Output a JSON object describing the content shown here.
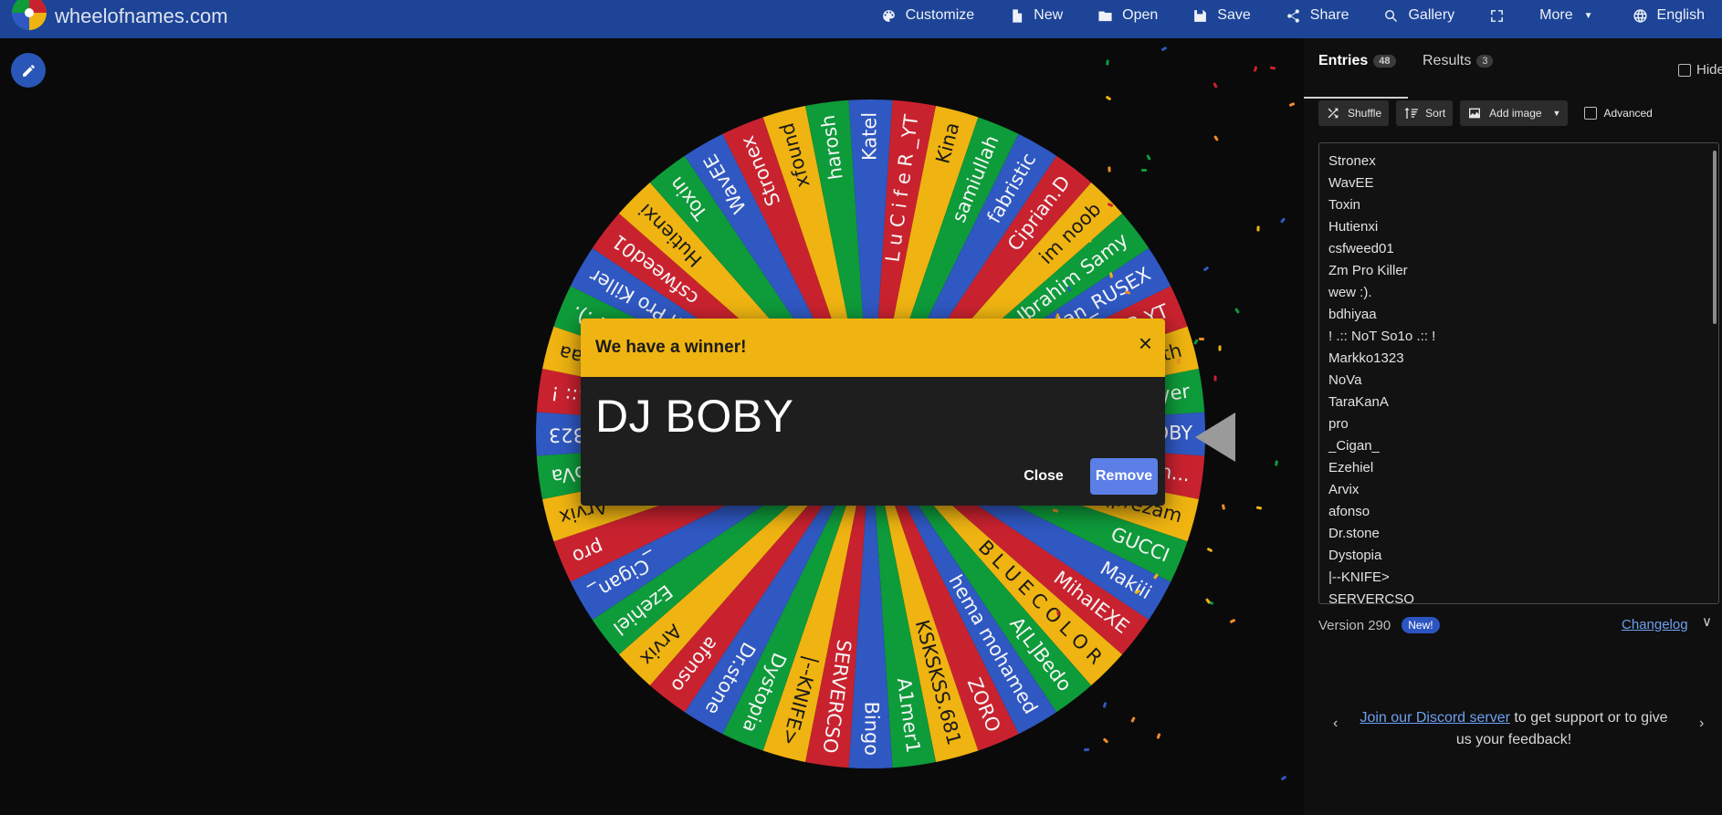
{
  "header": {
    "site_title": "wheelofnames.com",
    "menu": [
      {
        "label": "Customize",
        "icon": "palette-icon"
      },
      {
        "label": "New",
        "icon": "file-icon"
      },
      {
        "label": "Open",
        "icon": "folder-icon"
      },
      {
        "label": "Save",
        "icon": "save-icon"
      },
      {
        "label": "Share",
        "icon": "share-icon"
      },
      {
        "label": "Gallery",
        "icon": "search-icon"
      },
      {
        "label": "",
        "icon": "fullscreen-icon"
      },
      {
        "label": "More",
        "icon": "chevron-down-icon"
      },
      {
        "label": "English",
        "icon": "globe-icon"
      }
    ]
  },
  "wheel": {
    "segment_colors": [
      "#2f58c2",
      "#c9222f",
      "#efb411",
      "#0e9b3a"
    ],
    "labels": [
      "DJ BOBY",
      "ChipiChipiChapaCh...",
      "qprezam",
      "GUCCI",
      "Makiii",
      "MihaIEXE",
      "B L U E C O L O R",
      "A[L]Bedo",
      "hema mohamed",
      "ZORO",
      "KSKSKSS.681",
      "A1mer1",
      "Bingo",
      "SERVERCSO",
      "|--KNIFE>",
      "Dystopia",
      "Dr.stone",
      "afonso",
      "Arvix",
      "Ezehiel",
      "_Cigan_",
      "pro",
      "Arvix",
      "NoVa",
      "Markko1323",
      "! .:: NoT So1o .:: !",
      "bdhiyaa",
      "wew :).",
      "Zm Pro Killer",
      "csfweed01",
      "Hutienxi",
      "Toxin",
      "WavEE",
      "Stronex",
      "xfound",
      "harosh",
      "Katel",
      "L u C i f e R _YT",
      "Kina",
      "samiullah",
      "fabristic",
      "Ciprian.D",
      "im noob",
      "Ibrahim Samy",
      "Ruslan_RUSEX",
      "L U C I F E R YT",
      "Jutamenth",
      "Gamer player"
    ]
  },
  "modal": {
    "title": "We have a winner!",
    "close_x": "×",
    "winner": "DJ BOBY",
    "close_label": "Close",
    "remove_label": "Remove"
  },
  "panel": {
    "tab_entries": "Entries",
    "entries_count": "48",
    "tab_results": "Results",
    "results_count": "3",
    "hide_label": "Hide",
    "shuffle_label": "Shuffle",
    "sort_label": "Sort",
    "add_image_label": "Add image",
    "advanced_label": "Advanced",
    "entries": [
      "Stronex",
      "WavEE",
      "Toxin",
      "Hutienxi",
      "csfweed01",
      "Zm Pro Killer",
      "wew :).",
      "bdhiyaa",
      "! .:: NoT So1o .:: !",
      "Markko1323",
      "NoVa",
      "TaraKanA",
      "pro",
      "_Cigan_",
      "Ezehiel",
      "Arvix",
      "afonso",
      "Dr.stone",
      "Dystopia",
      "|--KNIFE>",
      "SERVERCSO"
    ],
    "version_label": "Version 290",
    "new_badge": "New!",
    "changelog_label": "Changelog",
    "discord_link": "Join our Discord server",
    "discord_rest": " to get support or to give us your feedback!",
    "arrow_left": "‹",
    "arrow_right": "›"
  },
  "colors": {
    "topbar": "#1d4496",
    "modal_header": "#efb411",
    "remove_button": "#5b7fe6",
    "link": "#6da0f0"
  }
}
